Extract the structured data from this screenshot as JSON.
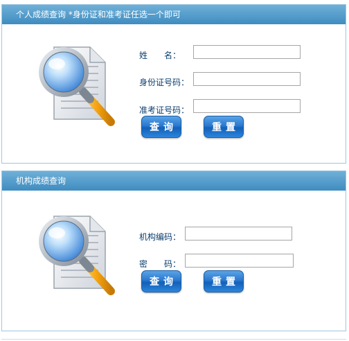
{
  "personal": {
    "header": "个人成绩查询  *身份证和准考证任选一个即可",
    "name_label": "姓　　名：",
    "name_value": "",
    "id_label": "身份证号码：",
    "id_value": "",
    "exam_label": "准考证号码：",
    "exam_value": "",
    "query_button": "查询",
    "reset_button": "重置"
  },
  "org": {
    "header": "机构成绩查询",
    "code_label": "机构编码：",
    "code_value": "",
    "password_label": "密　　码：",
    "password_value": "",
    "query_button": "查询",
    "reset_button": "重置"
  },
  "icons": {
    "search_document": "magnifier-over-document-icon"
  },
  "colors": {
    "header_blue": "#4a96c9",
    "panel_border": "#9cc7de",
    "label_text": "#0b3e6e",
    "button_blue": "#2a78cf"
  }
}
